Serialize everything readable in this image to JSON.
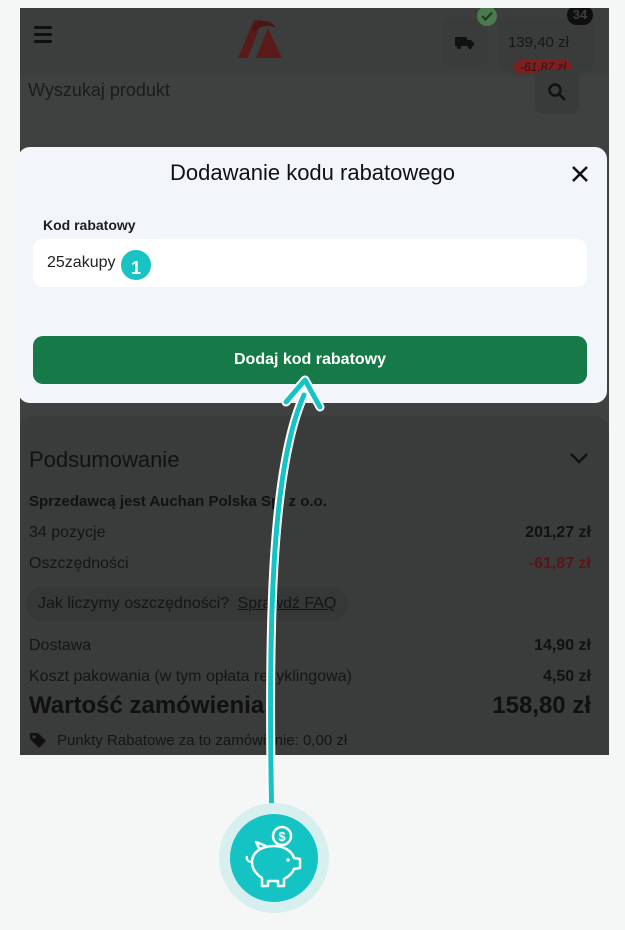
{
  "header": {
    "cart_amount": "139,40 zł",
    "cart_saving": "-61,87 zł",
    "cart_count": "34"
  },
  "search": {
    "placeholder": "Wyszukaj produkt"
  },
  "modal": {
    "title": "Dodawanie kodu rabatowego",
    "field_label": "Kod rabatowy",
    "field_value": "25zakupy",
    "button_label": "Dodaj kod rabatowy"
  },
  "annotation": {
    "step_number": "1"
  },
  "summary": {
    "title": "Podsumowanie",
    "seller": "Sprzedawcą jest Auchan Polska Sp. z o.o.",
    "rows": [
      {
        "label": "34 pozycje",
        "value": "201,27 zł"
      },
      {
        "label": "Oszczędności",
        "value": "-61,87 zł"
      },
      {
        "label": "Dostawa",
        "value": "14,90 zł"
      },
      {
        "label": "Koszt pakowania (w tym opłata recyklingowa)",
        "value": "4,50 zł"
      }
    ],
    "faq_question": "Jak liczymy oszczędności?",
    "faq_link": "Sprawdź FAQ",
    "total_label": "Wartość zamówienia",
    "total_value": "158,80 zł",
    "points_text": "Punkty Rabatowe za to zamówienie: 0,00 zł"
  },
  "colors": {
    "accent_teal": "#19c3c4",
    "button_green": "#157a47",
    "saving_red": "#b3262a"
  },
  "icons": {
    "menu": "hamburger-icon",
    "delivery": "truck-icon",
    "search": "search-icon",
    "close": "close-icon",
    "piggy": "piggy-bank-icon"
  }
}
